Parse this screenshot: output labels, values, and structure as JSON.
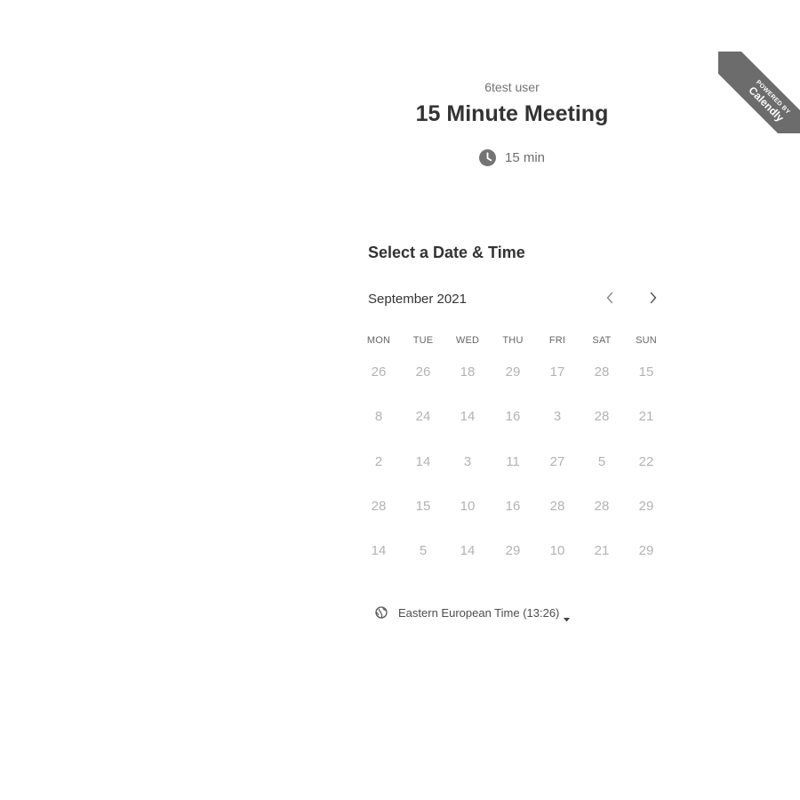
{
  "ribbon": {
    "powered_by": "POWERED BY",
    "brand": "Calendly"
  },
  "header": {
    "owner_name": "6test user",
    "event_title": "15 Minute Meeting",
    "duration": "15 min"
  },
  "calendar": {
    "section_title": "Select a Date & Time",
    "month_label": "September 2021",
    "weekdays": [
      "MON",
      "TUE",
      "WED",
      "THU",
      "FRI",
      "SAT",
      "SUN"
    ],
    "weeks": [
      [
        "26",
        "26",
        "18",
        "29",
        "17",
        "28",
        "15"
      ],
      [
        "8",
        "24",
        "14",
        "16",
        "3",
        "28",
        "21"
      ],
      [
        "2",
        "14",
        "3",
        "11",
        "27",
        "5",
        "22"
      ],
      [
        "28",
        "15",
        "10",
        "16",
        "28",
        "28",
        "29"
      ],
      [
        "14",
        "5",
        "14",
        "29",
        "10",
        "21",
        "29"
      ]
    ]
  },
  "timezone": {
    "label": "Eastern European Time (13:26)"
  },
  "colors": {
    "ribbon": "#6c6c6c",
    "title": "#333333",
    "muted": "#737373",
    "day_disabled": "#b3b3b3"
  },
  "icons": {
    "duration": "clock-icon",
    "timezone": "globe-icon",
    "prev": "chevron-left-icon",
    "next": "chevron-right-icon",
    "dropdown": "caret-down-icon"
  }
}
